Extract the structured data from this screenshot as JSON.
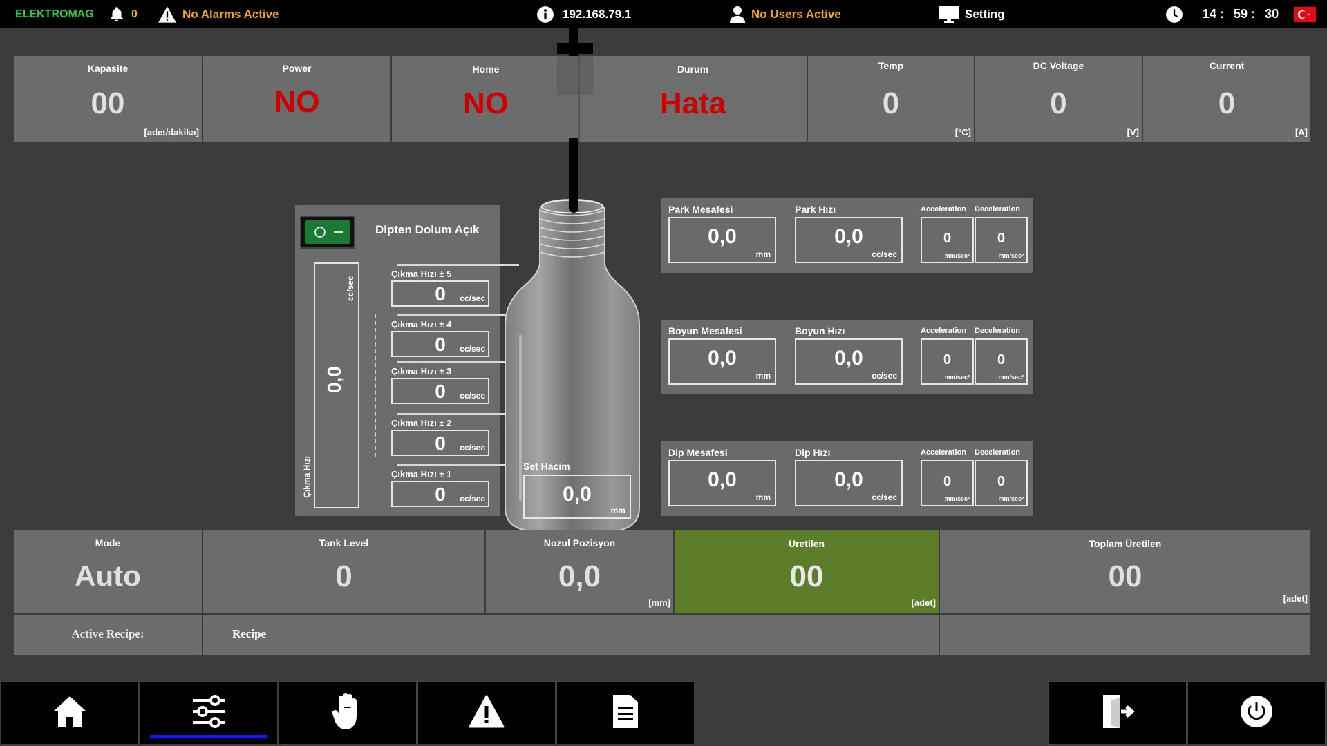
{
  "topbar": {
    "brand": "ELEKTROMAG",
    "bell_count": "0",
    "alarm_text": "No Alarms Active",
    "ip": "192.168.79.1",
    "users_text": "No Users Active",
    "setting_label": "Setting",
    "clock": {
      "h": "14 :",
      "m": "59 :",
      "s": "30"
    },
    "colors": {
      "brand": "#2ecc40",
      "warn": "#f5a623"
    }
  },
  "status": [
    {
      "label": "Kapasite",
      "value": "00",
      "unit": "[adet/dakika]",
      "color": "#e0e0e0"
    },
    {
      "label": "Power",
      "value": "NO",
      "unit": "",
      "color": "#cc0000"
    },
    {
      "label": "Home",
      "value": "NO",
      "unit": "",
      "color": "#cc0000"
    },
    {
      "label": "Durum",
      "value": "Hata",
      "unit": "",
      "color": "#cc0000"
    },
    {
      "label": "Temp",
      "value": "0",
      "unit": "[°C]",
      "color": "#e0e0e0"
    },
    {
      "label": "DC Voltage",
      "value": "0",
      "unit": "[V]",
      "color": "#e0e0e0"
    },
    {
      "label": "Current",
      "value": "0",
      "unit": "[A]",
      "color": "#e0e0e0"
    }
  ],
  "fill_panel": {
    "toggle_title": "Dipten Dolum Açık",
    "vertical_label": "Çıkma Hızı",
    "vertical_unit": "cc/sec",
    "vertical_value": "0,0",
    "items": [
      {
        "label": "Çıkma Hızı ± 5",
        "value": "0",
        "unit": "cc/sec"
      },
      {
        "label": "Çıkma Hızı ± 4",
        "value": "0",
        "unit": "cc/sec"
      },
      {
        "label": "Çıkma Hızı ± 3",
        "value": "0",
        "unit": "cc/sec"
      },
      {
        "label": "Çıkma Hızı ± 2",
        "value": "0",
        "unit": "cc/sec"
      },
      {
        "label": "Çıkma Hızı ± 1",
        "value": "0",
        "unit": "cc/sec"
      }
    ]
  },
  "set_volume": {
    "label": "Set Hacim",
    "value": "0,0",
    "unit": "mm"
  },
  "cards": [
    {
      "dist_label": "Park Mesafesi",
      "dist_value": "0,0",
      "dist_unit": "mm",
      "speed_label": "Park Hızı",
      "speed_value": "0,0",
      "speed_unit": "cc/sec",
      "acc_label": "Acceleration",
      "acc_value": "0",
      "acc_unit": "mm/sec²",
      "dec_label": "Deceleration",
      "dec_value": "0",
      "dec_unit": "mm/sec²"
    },
    {
      "dist_label": "Boyun Mesafesi",
      "dist_value": "0,0",
      "dist_unit": "mm",
      "speed_label": "Boyun Hızı",
      "speed_value": "0,0",
      "speed_unit": "cc/sec",
      "acc_label": "Acceleration",
      "acc_value": "0",
      "acc_unit": "mm/sec²",
      "dec_label": "Deceleration",
      "dec_value": "0",
      "dec_unit": "mm/sec²"
    },
    {
      "dist_label": "Dip Mesafesi",
      "dist_value": "0,0",
      "dist_unit": "mm",
      "speed_label": "Dip Hızı",
      "speed_value": "0,0",
      "speed_unit": "cc/sec",
      "acc_label": "Acceleration",
      "acc_value": "0",
      "acc_unit": "mm/sec²",
      "dec_label": "Deceleration",
      "dec_value": "0",
      "dec_unit": "mm/sec²"
    }
  ],
  "bottom": {
    "mode": {
      "label": "Mode",
      "value": "Auto"
    },
    "tank": {
      "label": "Tank Level",
      "value": "0"
    },
    "nozzle": {
      "label": "Nozul Pozisyon",
      "value": "0,0",
      "unit": "[mm]"
    },
    "produced": {
      "label": "Üretilen",
      "value": "00",
      "unit": "[adet]",
      "color": "#5e7d2a"
    },
    "total": {
      "label": "Toplam Üretilen",
      "value": "00",
      "unit": "[adet]"
    },
    "recipe_label": "Active Recipe:",
    "recipe_value": "Recipe"
  },
  "nav": [
    "home-icon",
    "sliders-icon",
    "hand-icon",
    "warning-icon",
    "document-icon",
    "exit-door-icon",
    "power-icon"
  ]
}
